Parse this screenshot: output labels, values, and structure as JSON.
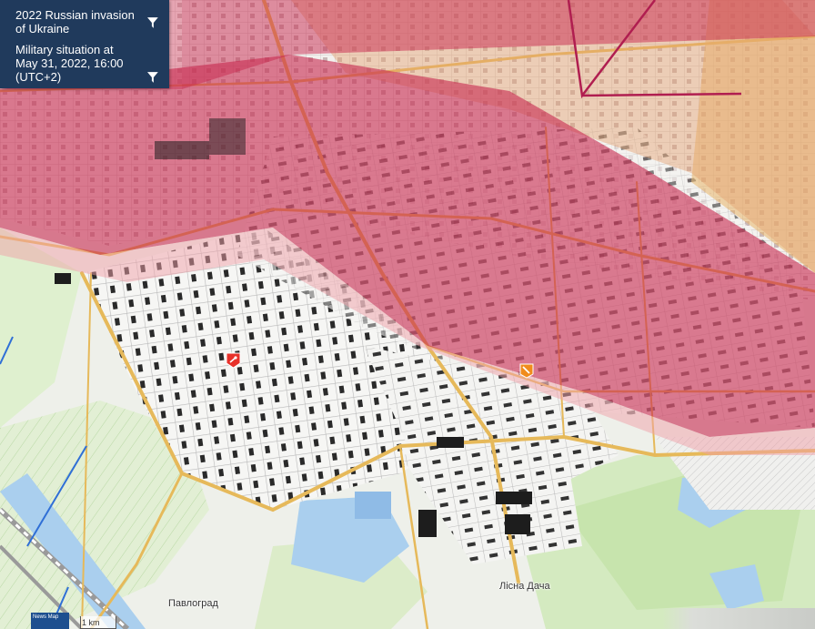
{
  "panel": {
    "title": "2022 Russian invasion of Ukraine",
    "subtitle_line1": "Military situation at",
    "subtitle_line2": "May 31, 2022, 16:00",
    "subtitle_line3": "(UTC+2)"
  },
  "map": {
    "place_labels": {
      "town": "Павлоград",
      "district": "Лісна Дача"
    },
    "scale": "1 km",
    "logo_text": "News Map"
  },
  "colors": {
    "panel_bg": "#203a5c",
    "occupied_zone": "#c8284e",
    "contested_zone": "#f0a0a8",
    "outer_zone": "#e8b46a",
    "roads": "#e6b95a",
    "water": "#aacfee",
    "forest": "#cfe6b8",
    "front_line": "#b01e50",
    "marker_red": "#e8312a",
    "marker_orange": "#f08c1c"
  },
  "icons": {
    "filter": "filter-icon",
    "marker_red": "explosion-marker-icon",
    "marker_orange": "shelling-marker-icon"
  }
}
